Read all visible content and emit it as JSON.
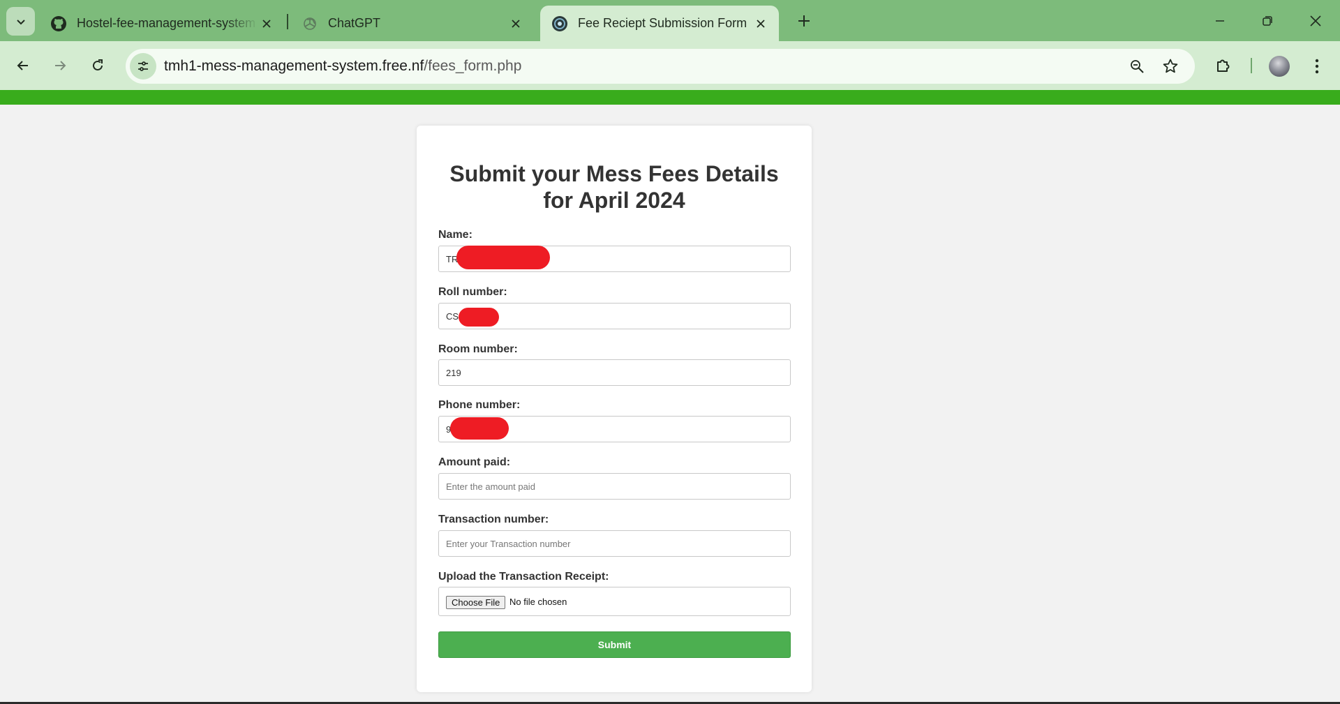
{
  "browser": {
    "tabs": [
      {
        "title": "Hostel-fee-management-system",
        "icon": "github-icon"
      },
      {
        "title": "ChatGPT",
        "icon": "chatgpt-icon"
      },
      {
        "title": "Fee Reciept Submission Form",
        "icon": "site-favicon",
        "active": true
      }
    ],
    "url": {
      "host": "tmh1-mess-management-system.free.nf",
      "path": "/fees_form.php"
    }
  },
  "colors": {
    "chrome": "#7dbb7b",
    "toolbar": "#d4ecd1",
    "page_bar": "#39ac1c",
    "submit": "#4caf50",
    "redaction": "#ee1c24"
  },
  "form": {
    "title_line1": "Submit your Mess Fees Details",
    "title_line2": "for April 2024",
    "name": {
      "label": "Name:",
      "value": "TR"
    },
    "roll": {
      "label": "Roll number:",
      "value": "CS"
    },
    "room": {
      "label": "Room number:",
      "value": "219"
    },
    "phone": {
      "label": "Phone number:",
      "value": "9"
    },
    "amount": {
      "label": "Amount paid:",
      "placeholder": "Enter the amount paid"
    },
    "transaction": {
      "label": "Transaction number:",
      "placeholder": "Enter your Transaction number"
    },
    "receipt": {
      "label": "Upload the Transaction Receipt:",
      "button": "Choose File",
      "status": "No file chosen"
    },
    "submit": "Submit"
  }
}
